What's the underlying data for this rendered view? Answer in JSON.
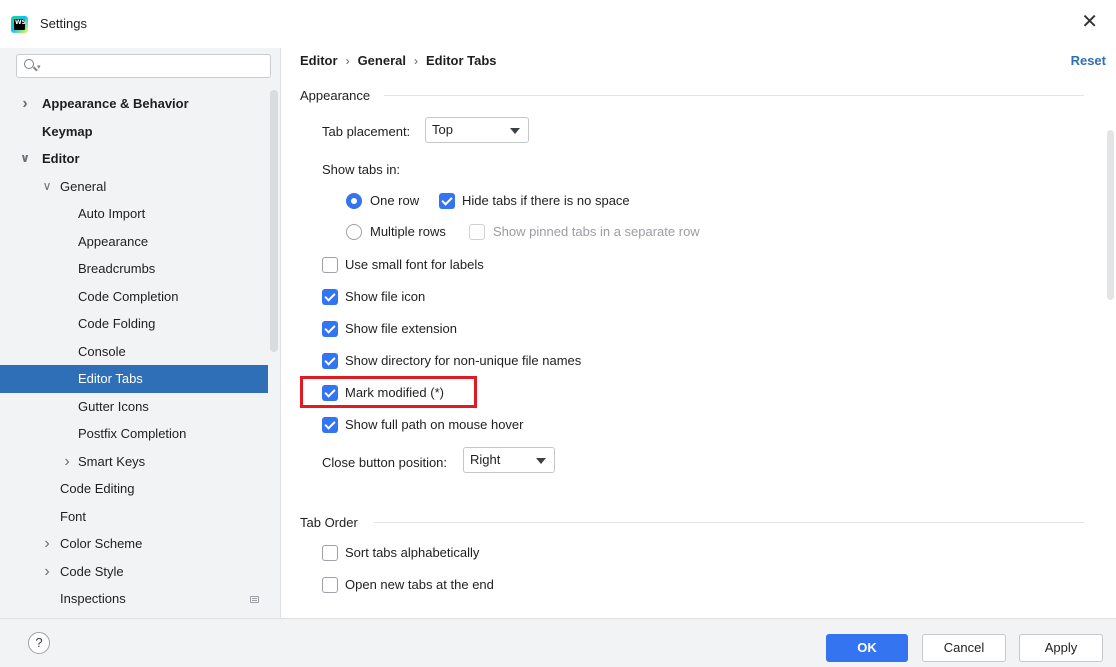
{
  "window": {
    "title": "Settings",
    "icon_text": "WS"
  },
  "search": {
    "placeholder": "",
    "value": ""
  },
  "sidebar": {
    "items": [
      {
        "label": "Appearance & Behavior",
        "level": 0,
        "expander": "collapsed",
        "bold": true
      },
      {
        "label": "Keymap",
        "level": 0,
        "expander": "none",
        "bold": true
      },
      {
        "label": "Editor",
        "level": 0,
        "expander": "expanded",
        "bold": true
      },
      {
        "label": "General",
        "level": 1,
        "expander": "expanded"
      },
      {
        "label": "Auto Import",
        "level": 2
      },
      {
        "label": "Appearance",
        "level": 2
      },
      {
        "label": "Breadcrumbs",
        "level": 2
      },
      {
        "label": "Code Completion",
        "level": 2
      },
      {
        "label": "Code Folding",
        "level": 2
      },
      {
        "label": "Console",
        "level": 2
      },
      {
        "label": "Editor Tabs",
        "level": 2,
        "selected": true
      },
      {
        "label": "Gutter Icons",
        "level": 2
      },
      {
        "label": "Postfix Completion",
        "level": 2
      },
      {
        "label": "Smart Keys",
        "level": 2,
        "expander": "collapsed"
      },
      {
        "label": "Code Editing",
        "level": 1
      },
      {
        "label": "Font",
        "level": 1
      },
      {
        "label": "Color Scheme",
        "level": 1,
        "expander": "collapsed"
      },
      {
        "label": "Code Style",
        "level": 1,
        "expander": "collapsed"
      },
      {
        "label": "Inspections",
        "level": 1
      }
    ]
  },
  "breadcrumb": {
    "items": [
      "Editor",
      "General",
      "Editor Tabs"
    ],
    "separator": "›"
  },
  "reset_label": "Reset",
  "appearance": {
    "title": "Appearance",
    "tab_placement": {
      "label": "Tab placement:",
      "value": "Top"
    },
    "show_tabs_in": {
      "label": "Show tabs in:",
      "one_row": {
        "label": "One row",
        "selected": true
      },
      "hide_tabs": {
        "label": "Hide tabs if there is no space",
        "checked": true
      },
      "multiple_rows": {
        "label": "Multiple rows",
        "selected": false
      },
      "show_pinned": {
        "label": "Show pinned tabs in a separate row",
        "checked": false,
        "disabled": true
      }
    },
    "checkboxes": [
      {
        "label": "Use small font for labels",
        "checked": false
      },
      {
        "label": "Show file icon",
        "checked": true
      },
      {
        "label": "Show file extension",
        "checked": true
      },
      {
        "label": "Show directory for non-unique file names",
        "checked": true
      },
      {
        "label": "Mark modified (*)",
        "checked": true,
        "highlighted": true
      },
      {
        "label": "Show full path on mouse hover",
        "checked": true
      }
    ],
    "close_button": {
      "label": "Close button position:",
      "value": "Right"
    }
  },
  "tab_order": {
    "title": "Tab Order",
    "checkboxes": [
      {
        "label": "Sort tabs alphabetically",
        "checked": false
      },
      {
        "label": "Open new tabs at the end",
        "checked": false
      }
    ]
  },
  "footer": {
    "help": "?",
    "ok": "OK",
    "cancel": "Cancel",
    "apply": "Apply"
  },
  "colors": {
    "accent": "#3574f0",
    "selection": "#2e6fb8",
    "highlight_box": "#e01b24",
    "link": "#2e6fb8"
  }
}
